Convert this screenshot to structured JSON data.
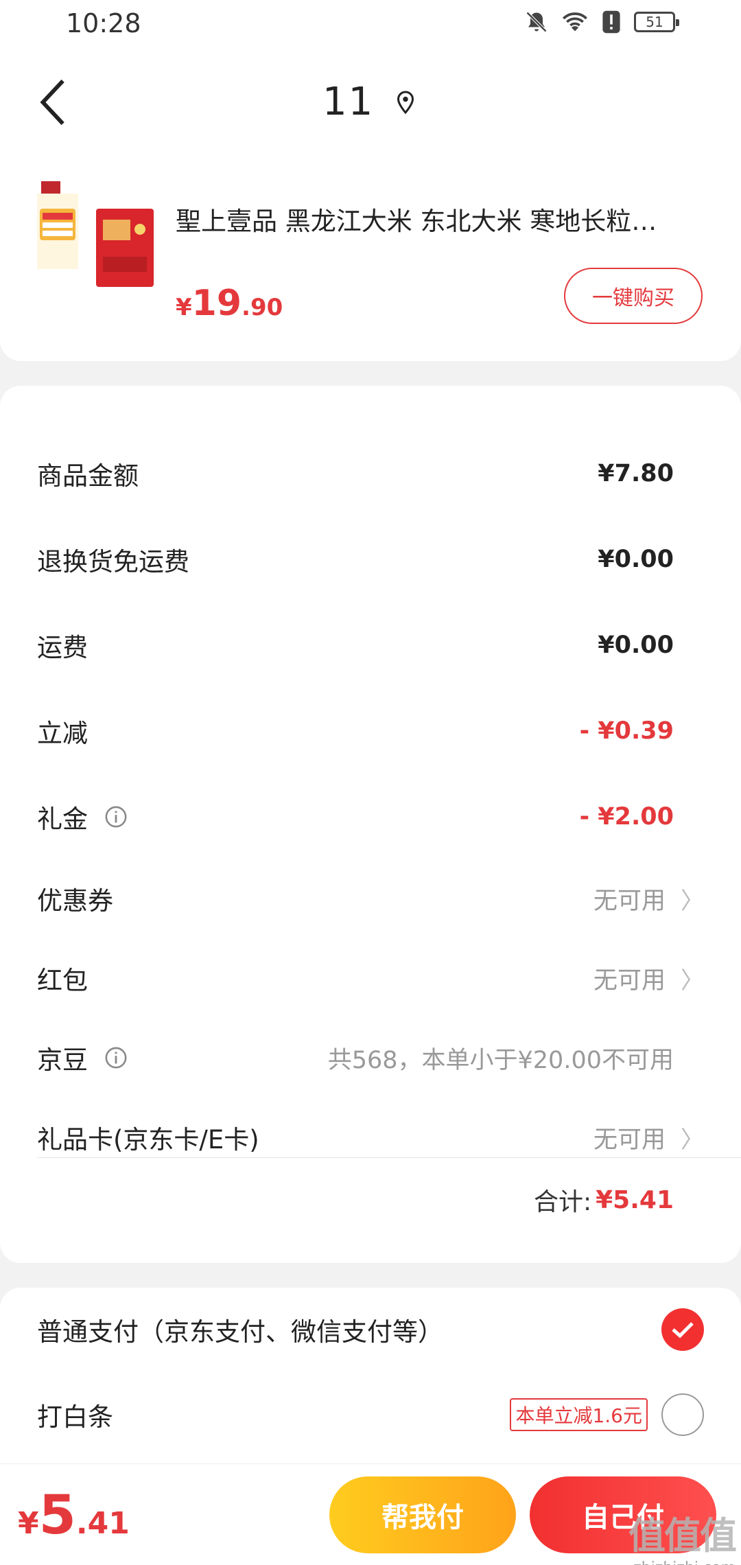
{
  "status_bar": {
    "time": "10:28",
    "battery": "51",
    "icons": [
      "mute-bell-icon",
      "wifi-icon",
      "alert-icon",
      "battery-icon"
    ]
  },
  "header": {
    "title": "11",
    "location_icon": "location-pin-icon",
    "back_icon": "chevron-left-icon"
  },
  "product": {
    "title": "聖上壹品 黑龙江大米 东北大米 寒地长粒…",
    "price_currency": "¥",
    "price_int": "19",
    "price_dec": ".90",
    "buy_button": "一键购买",
    "image_alt": "五常 大米"
  },
  "fees": {
    "rows": [
      {
        "label": "商品金额",
        "value": "¥7.80",
        "style": "normal"
      },
      {
        "label": "退换货免运费",
        "value": "¥0.00",
        "style": "normal"
      },
      {
        "label": "运费",
        "value": "¥0.00",
        "style": "normal"
      },
      {
        "label": "立减",
        "value": "- ¥0.39",
        "style": "red"
      },
      {
        "label": "礼金",
        "value": "- ¥2.00",
        "style": "red",
        "info": true
      },
      {
        "label": "优惠券",
        "value": "无可用",
        "style": "gray",
        "chevron": true
      },
      {
        "label": "红包",
        "value": "无可用",
        "style": "gray",
        "chevron": true
      },
      {
        "label": "京豆",
        "value": "共568，本单小于¥20.00不可用",
        "style": "gray",
        "info": true
      },
      {
        "label": "礼品卡(京东卡/E卡)",
        "value": "无可用",
        "style": "gray",
        "chevron": true
      }
    ],
    "total_label": "合计:",
    "total_value": "¥5.41"
  },
  "payment": {
    "options": [
      {
        "label": "普通支付（京东支付、微信支付等）",
        "selected": true
      },
      {
        "label": "打白条",
        "selected": false,
        "promo": "本单立减1.6元"
      }
    ]
  },
  "bottom": {
    "price_currency": "¥",
    "price_int": "5",
    "price_dec": ".41",
    "help_button": "帮我付",
    "self_button": "自己付",
    "watermark_main": "值值值",
    "watermark_sub": "zhizhizhi.com"
  },
  "colors": {
    "accent": "#e4393c",
    "yellow": "#ffb31a"
  }
}
